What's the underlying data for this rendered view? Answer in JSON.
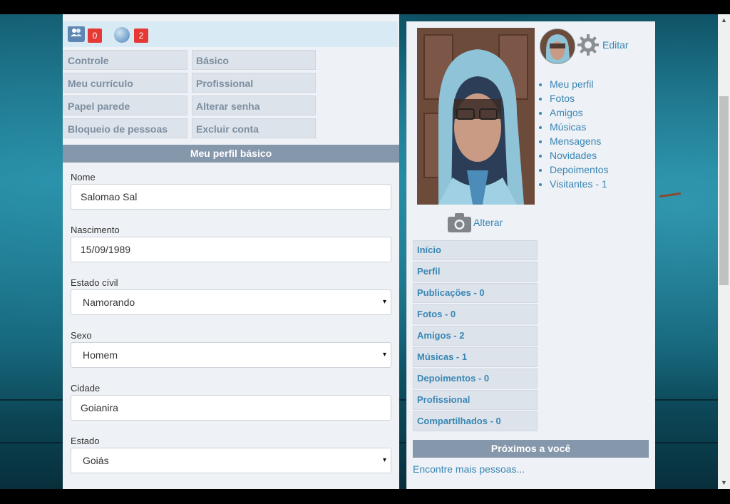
{
  "notifications": {
    "friends_count": "0",
    "global_count": "2"
  },
  "menu": {
    "col1": [
      "Controle",
      "Meu currículo",
      "Papel parede",
      "Bloqueio de pessoas"
    ],
    "col2": [
      "Básico",
      "Profissional",
      "Alterar senha",
      "Excluir conta"
    ]
  },
  "form": {
    "header": "Meu perfil básico",
    "fields": [
      {
        "label": "Nome",
        "value": "Salomao Sal",
        "type": "text"
      },
      {
        "label": "Nascimento",
        "value": "15/09/1989",
        "type": "text"
      },
      {
        "label": "Estado cívil",
        "value": "Namorando",
        "type": "select"
      },
      {
        "label": "Sexo",
        "value": "Homem",
        "type": "select"
      },
      {
        "label": "Cidade",
        "value": "Goianira",
        "type": "text"
      },
      {
        "label": "Estado",
        "value": "Goiás",
        "type": "select"
      }
    ],
    "select_arrow": "▾"
  },
  "profile": {
    "edit_label": "Editar",
    "change_photo_label": "Alterar",
    "links": [
      "Meu perfil",
      "Fotos",
      "Amigos",
      "Músicas",
      "Mensagens",
      "Novidades",
      "Depoimentos",
      "Visitantes - 1"
    ]
  },
  "nav": [
    "Início",
    "Perfil",
    "Publicações - 0",
    "Fotos - 0",
    "Amigos - 2",
    "Músicas - 1",
    "Depoimentos - 0",
    "Profissional",
    "Compartilhados - 0"
  ],
  "nearby": {
    "header": "Próximos a você",
    "link": "Encontre mais pessoas..."
  },
  "colors": {
    "accent": "#3a86b5",
    "header_bg": "#8597ab",
    "badge": "#e53935"
  },
  "icons": {
    "friends": "friends-icon",
    "globe": "globe-icon",
    "gear": "gear-icon",
    "camera": "camera-icon"
  }
}
